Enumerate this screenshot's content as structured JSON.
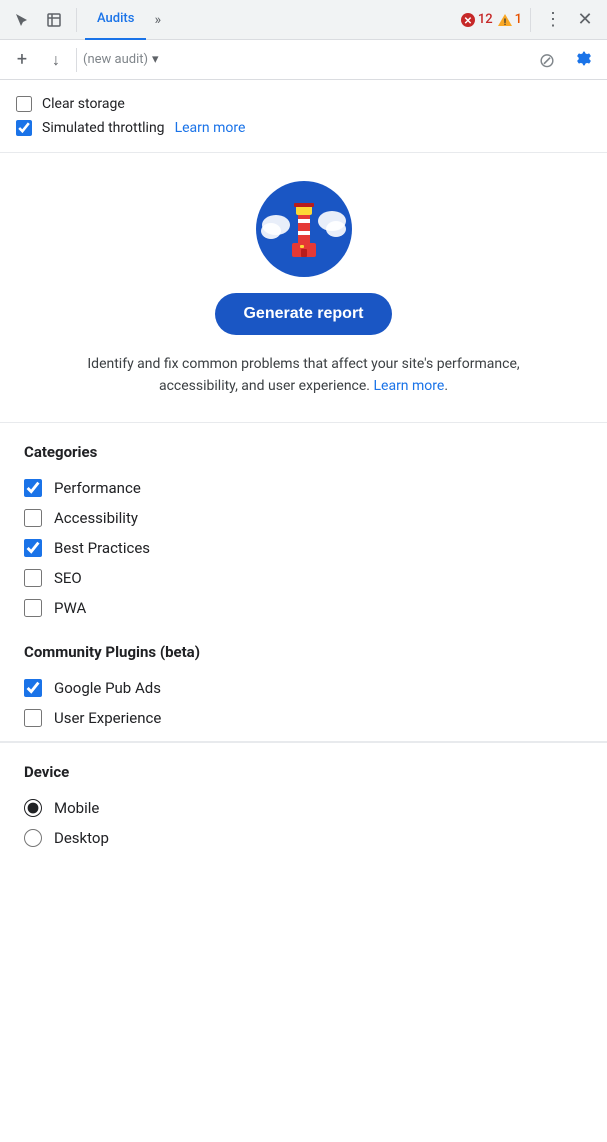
{
  "toolbar": {
    "cursor_icon": "⌖",
    "inspect_icon": "⬜",
    "tab_label": "Audits",
    "more_icon": "»",
    "error_count": "12",
    "warning_count": "1",
    "menu_icon": "⋮",
    "close_icon": "✕"
  },
  "toolbar2": {
    "add_icon": "+",
    "download_icon": "↓",
    "placeholder": "(new audit)",
    "dropdown_icon": "▾",
    "cancel_icon": "⊘",
    "gear_icon": "⚙"
  },
  "options": {
    "clear_storage_label": "Clear storage",
    "clear_storage_checked": false,
    "simulated_throttling_label": "Simulated throttling",
    "simulated_throttling_checked": true,
    "learn_more_label": "Learn more"
  },
  "hero": {
    "generate_btn_label": "Generate report",
    "description": "Identify and fix common problems that affect your site's performance, accessibility, and user experience.",
    "learn_more_label": "Learn more",
    "learn_more_suffix": "."
  },
  "categories": {
    "title": "Categories",
    "items": [
      {
        "label": "Performance",
        "checked": true
      },
      {
        "label": "Accessibility",
        "checked": false
      },
      {
        "label": "Best Practices",
        "checked": true
      },
      {
        "label": "SEO",
        "checked": false
      },
      {
        "label": "PWA",
        "checked": false
      }
    ]
  },
  "community_plugins": {
    "title": "Community Plugins (beta)",
    "items": [
      {
        "label": "Google Pub Ads",
        "checked": true
      },
      {
        "label": "User Experience",
        "checked": false
      }
    ]
  },
  "device": {
    "title": "Device",
    "options": [
      {
        "label": "Mobile",
        "selected": true
      },
      {
        "label": "Desktop",
        "selected": false
      }
    ]
  }
}
